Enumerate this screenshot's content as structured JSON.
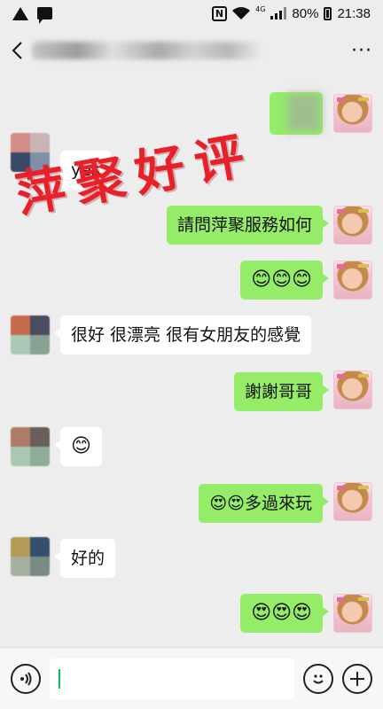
{
  "status_bar": {
    "battery_percent": "80%",
    "time": "21:38",
    "network": "4G",
    "nfc": "N"
  },
  "header": {
    "back_icon": "chevron-left",
    "more_icon": "···"
  },
  "watermark": "萍聚好评",
  "messages": [
    {
      "side": "right",
      "type": "sticker",
      "text": ""
    },
    {
      "side": "left",
      "type": "text",
      "text": "yes"
    },
    {
      "side": "right",
      "type": "text",
      "text": "請問萍聚服務如何"
    },
    {
      "side": "right",
      "type": "text",
      "text": "😊😊😊"
    },
    {
      "side": "left",
      "type": "text",
      "text": "很好 很漂亮 很有女朋友的感覺"
    },
    {
      "side": "right",
      "type": "text",
      "text": "謝謝哥哥"
    },
    {
      "side": "left",
      "type": "text",
      "text": "😊"
    },
    {
      "side": "right",
      "type": "text",
      "text": "😍😍多過來玩"
    },
    {
      "side": "left",
      "type": "text",
      "text": "好的"
    },
    {
      "side": "right",
      "type": "text",
      "text": "😍😍😍"
    }
  ],
  "input_bar": {
    "voice_icon": "voice-icon",
    "emoji_icon": "emoji-icon",
    "plus_icon": "plus-icon",
    "placeholder": ""
  },
  "colors": {
    "background": "#ededed",
    "sent_bubble": "#95ec69",
    "received_bubble": "#ffffff",
    "watermark": "#e8202a"
  }
}
